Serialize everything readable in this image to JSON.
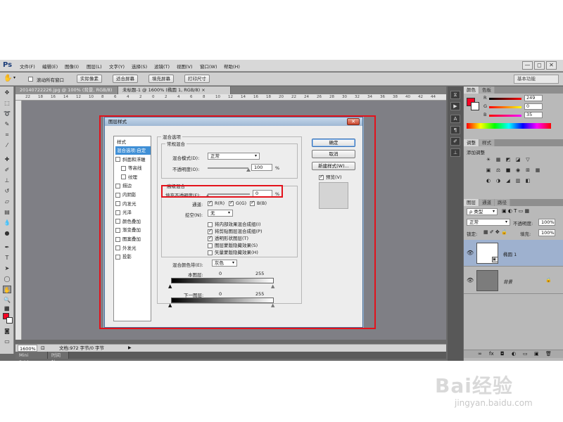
{
  "app": {
    "logo": "Ps",
    "menu": [
      "文件(F)",
      "编辑(E)",
      "图像(I)",
      "图层(L)",
      "文字(Y)",
      "选择(S)",
      "滤镜(T)",
      "视图(V)",
      "窗口(W)",
      "帮助(H)"
    ],
    "window_buttons": [
      "—",
      "◻",
      "✕"
    ]
  },
  "options_bar": {
    "scroll_all_label": "滚动所有窗口",
    "buttons": [
      "实际像素",
      "适合屏幕",
      "填充屏幕",
      "打印尺寸"
    ],
    "workspace": "基本功能"
  },
  "documents": {
    "tabs": [
      "20140722226.jpg @ 100% (背景, RGB/8) ×",
      "未标题-1 @ 1600% (椭圆 1, RGB/8) ×"
    ],
    "ruler_ticks": [
      "22",
      "18",
      "16",
      "14",
      "12",
      "10",
      "8",
      "6",
      "4",
      "2",
      "0",
      "2",
      "4",
      "6",
      "8",
      "10",
      "12",
      "14",
      "16",
      "18",
      "20",
      "22",
      "24",
      "26",
      "28",
      "30",
      "32",
      "34",
      "36",
      "38",
      "40",
      "42",
      "44"
    ]
  },
  "status": {
    "zoom": "1600%",
    "doc_info": "文档:972 字节/0 字节"
  },
  "bottom_tabs": [
    "Mini Bridge",
    "时间轴"
  ],
  "color_panel": {
    "tabs": [
      "颜色",
      "色板"
    ],
    "channels": [
      {
        "label": "R",
        "value": "249"
      },
      {
        "label": "G",
        "value": "0"
      },
      {
        "label": "B",
        "value": "35"
      }
    ],
    "fg_color": "#f90023"
  },
  "adjust_panel": {
    "tabs": [
      "调整",
      "样式"
    ],
    "title": "添加调整",
    "icons_row1": [
      "☀",
      "▦",
      "◩",
      "◪",
      "▽"
    ],
    "icons_row2": [
      "▣",
      "⚖",
      "■",
      "◉",
      "⊞",
      "▦"
    ],
    "icons_row3": [
      "◐",
      "◑",
      "◢",
      "▥",
      "◧"
    ]
  },
  "layers_panel": {
    "tabs": [
      "图层",
      "通道",
      "路径"
    ],
    "kind": "ρ 类型",
    "blend": "正常",
    "opacity_label": "不透明度:",
    "opacity": "100%",
    "lock_label": "锁定:",
    "fill_label": "填充:",
    "fill": "100%",
    "layers": [
      {
        "name": "椭圆 1",
        "selected": true
      },
      {
        "name": "背景",
        "selected": false
      }
    ],
    "footer_icons": [
      "∞",
      "fx",
      "◘",
      "◐",
      "▭",
      "▣",
      "🗑"
    ]
  },
  "dialog": {
    "title": "图层样式",
    "close": "✕",
    "style_list_header": "样式",
    "style_items": [
      {
        "label": "混合选项:自定",
        "checkbox": false,
        "checked": false,
        "selected": true,
        "indent": false
      },
      {
        "label": "斜面和浮雕",
        "checkbox": true,
        "checked": false,
        "selected": false,
        "indent": false
      },
      {
        "label": "等高线",
        "checkbox": true,
        "checked": false,
        "selected": false,
        "indent": true
      },
      {
        "label": "纹理",
        "checkbox": true,
        "checked": false,
        "selected": false,
        "indent": true
      },
      {
        "label": "描边",
        "checkbox": true,
        "checked": false,
        "selected": false,
        "indent": false
      },
      {
        "label": "内阴影",
        "checkbox": true,
        "checked": false,
        "selected": false,
        "indent": false
      },
      {
        "label": "内发光",
        "checkbox": true,
        "checked": false,
        "selected": false,
        "indent": false
      },
      {
        "label": "光泽",
        "checkbox": true,
        "checked": false,
        "selected": false,
        "indent": false
      },
      {
        "label": "颜色叠加",
        "checkbox": true,
        "checked": false,
        "selected": false,
        "indent": false
      },
      {
        "label": "渐变叠加",
        "checkbox": true,
        "checked": false,
        "selected": false,
        "indent": false
      },
      {
        "label": "图案叠加",
        "checkbox": true,
        "checked": false,
        "selected": false,
        "indent": false
      },
      {
        "label": "外发光",
        "checkbox": true,
        "checked": false,
        "selected": false,
        "indent": false
      },
      {
        "label": "投影",
        "checkbox": true,
        "checked": false,
        "selected": false,
        "indent": false
      }
    ],
    "blending": {
      "title": "混合选项",
      "general_title": "常规混合",
      "mode_label": "混合模式(D):",
      "mode_value": "正常",
      "opacity_label": "不透明度(O):",
      "opacity_value": "100",
      "opacity_fraction": 1.0,
      "percent": "%",
      "advanced_title": "高级混合",
      "fill_label": "填充不透明度(F):",
      "fill_value": "0",
      "fill_fraction": 0.0,
      "channels_label": "通道:",
      "channels": [
        "R(R)",
        "G(G)",
        "B(B)"
      ],
      "knockout_label": "挖空(N):",
      "knockout_value": "无",
      "options": [
        {
          "label": "将内部效果混合成组(I)",
          "checked": false
        },
        {
          "label": "将剪贴图层混合成组(P)",
          "checked": true
        },
        {
          "label": "透明形状图层(T)",
          "checked": true
        },
        {
          "label": "图层蒙版隐藏效果(S)",
          "checked": false
        },
        {
          "label": "矢量蒙版隐藏效果(H)",
          "checked": false
        }
      ],
      "blend_if_label": "混合颜色带(E):",
      "blend_if_value": "灰色",
      "this_layer_label": "本图层:",
      "this_layer_low": "0",
      "this_layer_high": "255",
      "under_layer_label": "下一图层:",
      "under_layer_low": "0",
      "under_layer_high": "255"
    },
    "buttons": {
      "ok": "确定",
      "cancel": "取消",
      "new_style": "新建样式(W)...",
      "preview_label": "预览(V)",
      "preview_checked": true
    }
  },
  "watermark": {
    "logo": "Bai经验",
    "url": "jingyan.baidu.com"
  }
}
